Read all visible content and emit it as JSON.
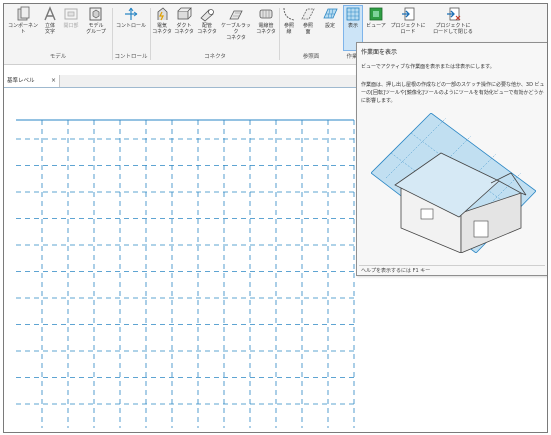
{
  "ribbon": {
    "groups": {
      "model": "モデル",
      "control": "コントロール",
      "connector": "コネクタ",
      "datum": "参照面",
      "work_plane": "作業"
    },
    "tools": {
      "component": "コンポーネント",
      "model_text_1": "立体",
      "model_text_2": "文字",
      "opening": "開口部",
      "model_group_1": "モデル",
      "model_group_2": "グループ",
      "control": "コントロール",
      "electrical_1": "電気",
      "electrical_2": "コネクタ",
      "duct_1": "ダクト",
      "duct_2": "コネクタ",
      "pipe_1": "配管",
      "pipe_2": "コネクタ",
      "cable_tray_1": "ケーブルラック",
      "cable_tray_2": "コネクタ",
      "conduit_1": "電線管",
      "conduit_2": "コネクタ",
      "ref_line_1": "参照",
      "ref_line_2": "線",
      "ref_plane_1": "参照",
      "ref_plane_2": "面",
      "set": "設定",
      "show": "表示",
      "viewer": "ビューア",
      "load_project_1": "プロジェクトに",
      "load_project_2": "ロード",
      "load_close_1": "プロジェクトに",
      "load_close_2": "ロードして閉じる"
    }
  },
  "tab": {
    "label": "基準レベル",
    "close": "×"
  },
  "tooltip": {
    "title": "作業面を表示",
    "description": "ビューでアクティブな作業面を表示または非表示にします。",
    "detail": "作業面は、押し出し屋根の作成などの一部のスケッチ操作に必要な他か、3D ビューの[回転]ツールや[鏡像化]ツールのようにツールを有効化ビューで有効かどうかに影響します。",
    "help": "ヘルプを表示するには F1 キー"
  },
  "colors": {
    "grid_line": "#2a86c4",
    "accent": "#2a86c4",
    "highlight": "#cce4f7",
    "plane_fill": "#b7dbf0"
  }
}
